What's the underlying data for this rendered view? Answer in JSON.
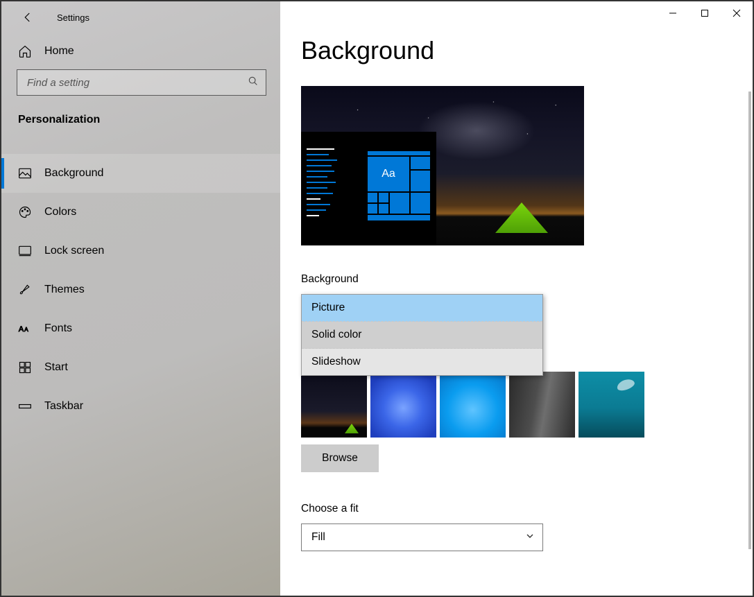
{
  "window": {
    "title": "Settings"
  },
  "sidebar": {
    "home_label": "Home",
    "search_placeholder": "Find a setting",
    "section": "Personalization",
    "items": [
      {
        "label": "Background",
        "icon": "image-icon",
        "active": true
      },
      {
        "label": "Colors",
        "icon": "palette-icon"
      },
      {
        "label": "Lock screen",
        "icon": "lock-screen-icon"
      },
      {
        "label": "Themes",
        "icon": "brush-icon"
      },
      {
        "label": "Fonts",
        "icon": "fonts-icon"
      },
      {
        "label": "Start",
        "icon": "start-icon"
      },
      {
        "label": "Taskbar",
        "icon": "taskbar-icon"
      }
    ]
  },
  "main": {
    "title": "Background",
    "preview_sample_text": "Aa",
    "background_label": "Background",
    "background_options": [
      "Picture",
      "Solid color",
      "Slideshow"
    ],
    "background_selected": "Picture",
    "browse_label": "Browse",
    "fit_label": "Choose a fit",
    "fit_selected": "Fill"
  }
}
